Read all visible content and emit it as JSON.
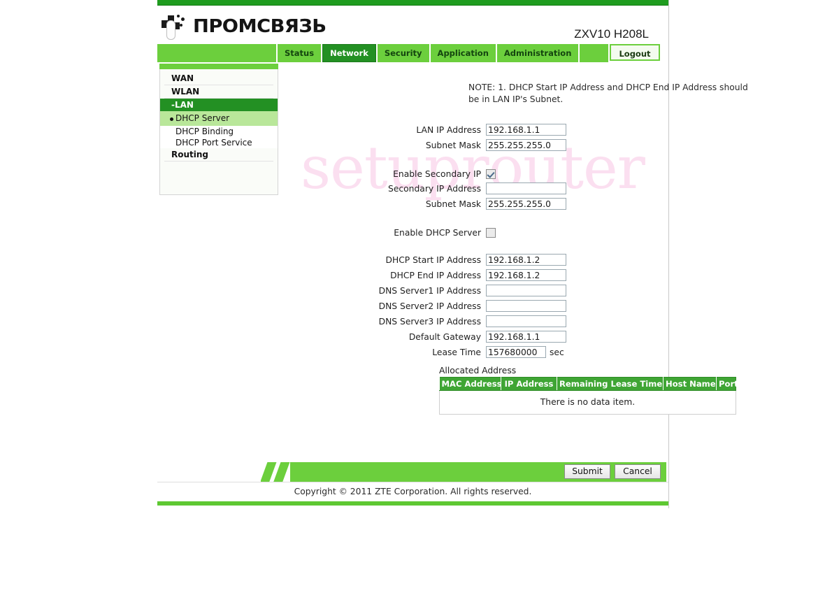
{
  "brand": {
    "logo_text": "ПРОМСВЯЗЬ",
    "model": "ZXV10 H208L"
  },
  "nav": {
    "tabs": [
      {
        "label": "Status",
        "active": false
      },
      {
        "label": "Network",
        "active": true
      },
      {
        "label": "Security",
        "active": false
      },
      {
        "label": "Application",
        "active": false
      },
      {
        "label": "Administration",
        "active": false
      }
    ],
    "logout_label": "Logout"
  },
  "sidebar": {
    "items": [
      {
        "label": "WAN"
      },
      {
        "label": "WLAN"
      },
      {
        "label": "-LAN"
      }
    ],
    "sub_items": [
      {
        "label": "DHCP Server",
        "current": true
      },
      {
        "label": "DHCP Binding",
        "current": false
      },
      {
        "label": "DHCP Port Service",
        "current": false
      }
    ],
    "routing_label": "Routing"
  },
  "watermark": "setuprouter",
  "form": {
    "note": "NOTE:  1. DHCP Start IP Address and DHCP End IP Address should be in LAN IP's Subnet.",
    "lan_ip_label": "LAN IP Address",
    "lan_ip_value": "192.168.1.1",
    "subnet_mask_label": "Subnet Mask",
    "subnet_mask_value": "255.255.255.0",
    "enable_secondary_ip_label": "Enable Secondary IP",
    "enable_secondary_ip_checked": true,
    "secondary_ip_label": "Secondary IP Address",
    "secondary_ip_value": "",
    "secondary_subnet_label": "Subnet Mask",
    "secondary_subnet_value": "255.255.255.0",
    "enable_dhcp_label": "Enable DHCP Server",
    "enable_dhcp_checked": false,
    "dhcp_start_label": "DHCP Start IP Address",
    "dhcp_start_value": "192.168.1.2",
    "dhcp_end_label": "DHCP End IP Address",
    "dhcp_end_value": "192.168.1.2",
    "dns1_label": "DNS Server1 IP Address",
    "dns1_value": "",
    "dns2_label": "DNS Server2 IP Address",
    "dns2_value": "",
    "dns3_label": "DNS Server3 IP Address",
    "dns3_value": "",
    "gateway_label": "Default Gateway",
    "gateway_value": "192.168.1.1",
    "lease_time_label": "Lease Time",
    "lease_time_value": "157680000",
    "lease_time_unit": "sec"
  },
  "allocated": {
    "title": "Allocated Address",
    "columns": [
      "MAC Address",
      "IP Address",
      "Remaining Lease Time",
      "Host Name",
      "Port"
    ],
    "empty_text": "There is no data item."
  },
  "actions": {
    "submit_label": "Submit",
    "cancel_label": "Cancel"
  },
  "footer": {
    "copyright": "Copyright © 2011 ZTE Corporation. All rights reserved."
  },
  "colors": {
    "bright_green": "#6ccf3d",
    "dark_green": "#239023",
    "top_stripe": "#1f9c1f",
    "table_header": "#3fa534",
    "sub_menu_green": "#b9e79a",
    "watermark_pink": "#fbdff0"
  }
}
